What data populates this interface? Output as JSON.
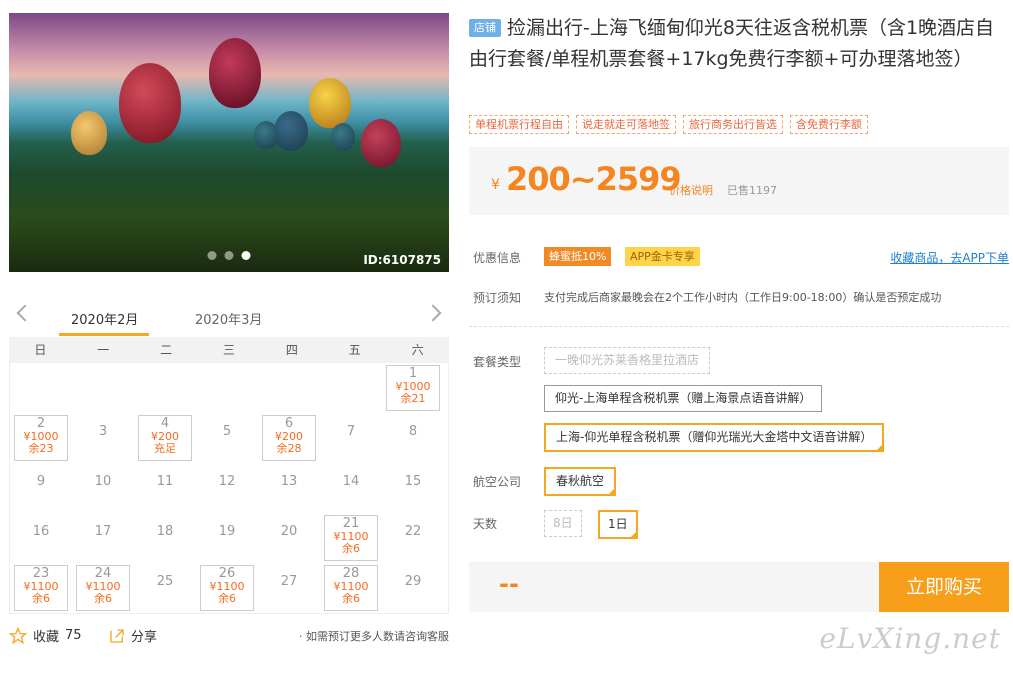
{
  "hero": {
    "id_label": "ID:6107875"
  },
  "calendar": {
    "month_current": "2020年2月",
    "month_next": "2020年3月",
    "weekdays": [
      "日",
      "一",
      "二",
      "三",
      "四",
      "五",
      "六"
    ],
    "cells": [
      {
        "day": "",
        "price": "",
        "stock": ""
      },
      {
        "day": "",
        "price": "",
        "stock": ""
      },
      {
        "day": "",
        "price": "",
        "stock": ""
      },
      {
        "day": "",
        "price": "",
        "stock": ""
      },
      {
        "day": "",
        "price": "",
        "stock": ""
      },
      {
        "day": "",
        "price": "",
        "stock": ""
      },
      {
        "day": "1",
        "price": "¥1000",
        "stock": "余21"
      },
      {
        "day": "2",
        "price": "¥1000",
        "stock": "余23"
      },
      {
        "day": "3",
        "price": "",
        "stock": ""
      },
      {
        "day": "4",
        "price": "¥200",
        "stock": "充足"
      },
      {
        "day": "5",
        "price": "",
        "stock": ""
      },
      {
        "day": "6",
        "price": "¥200",
        "stock": "余28"
      },
      {
        "day": "7",
        "price": "",
        "stock": ""
      },
      {
        "day": "8",
        "price": "",
        "stock": ""
      },
      {
        "day": "9",
        "price": "",
        "stock": ""
      },
      {
        "day": "10",
        "price": "",
        "stock": ""
      },
      {
        "day": "11",
        "price": "",
        "stock": ""
      },
      {
        "day": "12",
        "price": "",
        "stock": ""
      },
      {
        "day": "13",
        "price": "",
        "stock": ""
      },
      {
        "day": "14",
        "price": "",
        "stock": ""
      },
      {
        "day": "15",
        "price": "",
        "stock": ""
      },
      {
        "day": "16",
        "price": "",
        "stock": ""
      },
      {
        "day": "17",
        "price": "",
        "stock": ""
      },
      {
        "day": "18",
        "price": "",
        "stock": ""
      },
      {
        "day": "19",
        "price": "",
        "stock": ""
      },
      {
        "day": "20",
        "price": "",
        "stock": ""
      },
      {
        "day": "21",
        "price": "¥1100",
        "stock": "余6"
      },
      {
        "day": "22",
        "price": "",
        "stock": ""
      },
      {
        "day": "23",
        "price": "¥1100",
        "stock": "余6"
      },
      {
        "day": "24",
        "price": "¥1100",
        "stock": "余6"
      },
      {
        "day": "25",
        "price": "",
        "stock": ""
      },
      {
        "day": "26",
        "price": "¥1100",
        "stock": "余6"
      },
      {
        "day": "27",
        "price": "",
        "stock": ""
      },
      {
        "day": "28",
        "price": "¥1100",
        "stock": "余6"
      },
      {
        "day": "29",
        "price": "",
        "stock": ""
      }
    ]
  },
  "footer_left": {
    "fav_label": "收藏",
    "fav_count": "75",
    "share_label": "分享",
    "note": "· 如需预订更多人数请咨询客服"
  },
  "product": {
    "shop_badge": "店铺",
    "title": "捡漏出行-上海飞缅甸仰光8天往返含税机票（含1晚酒店自由行套餐/单程机票套餐+17kg免费行李额+可办理落地签）",
    "tags": [
      "单程机票行程自由",
      "说走就走可落地签",
      "旅行商务出行皆选",
      "含免费行李额"
    ],
    "price_symbol": "¥",
    "price": "200~2599",
    "price_note": "价格说明",
    "sold": "已售1197",
    "discount_label": "优惠信息",
    "discount_badge1": "蜂蜜抵10%",
    "discount_badge2": "APP金卡专享",
    "collect_link": "收藏商品，去APP下单",
    "booking_label": "预订须知",
    "booking_text": "支付完成后商家最晚会在2个工作小时内（工作日9:00-18:00）确认是否预定成功",
    "package_label": "套餐类型",
    "package_options": [
      "一晚仰光苏莱香格里拉酒店",
      "仰光-上海单程含税机票（赠上海景点语音讲解）",
      "上海-仰光单程含税机票（赠仰光瑞光大金塔中文语音讲解）"
    ],
    "airline_label": "航空公司",
    "airline_option": "春秋航空",
    "days_label": "天数",
    "days_options": [
      "8日",
      "1日"
    ],
    "total_placeholder": "--",
    "buy_label": "立即购买"
  },
  "watermark": "eLvXing.net",
  "colors": {
    "accent": "#f5851f",
    "buy": "#f79e1b",
    "link": "#1e7fce",
    "select_border": "#f5a623"
  }
}
